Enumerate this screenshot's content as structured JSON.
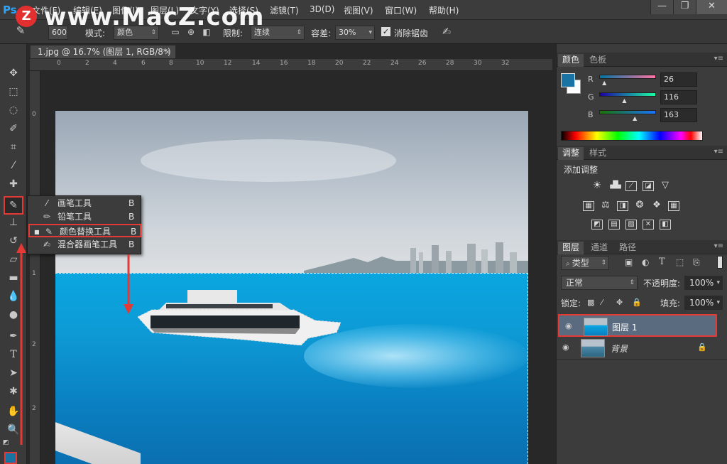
{
  "app": {
    "logo": "Ps",
    "menu": [
      "文件(F)",
      "编辑(E)",
      "图像(I)",
      "图层(L)",
      "文字(Y)",
      "选择(S)",
      "滤镜(T)",
      "3D(D)",
      "视图(V)",
      "窗口(W)",
      "帮助(H)"
    ],
    "window_buttons": [
      "—",
      "❐",
      "✕"
    ]
  },
  "watermark": {
    "logo": "Z",
    "text": "www.MacZ.com"
  },
  "options": {
    "brush_size": "600",
    "mode_label": "模式:",
    "mode_value": "颜色",
    "limit_label": "限制:",
    "limit_value": "连续",
    "tolerance_label": "容差:",
    "tolerance_value": "30%",
    "antialias_label": "消除锯齿",
    "antialias_checked": "✓"
  },
  "document": {
    "tab": "1.jpg @ 16.7% (图层 1, RGB/8*) *",
    "tab_close": "×",
    "ruler_top": [
      "0",
      "2",
      "4",
      "6",
      "8",
      "10",
      "12",
      "14",
      "16",
      "18",
      "20",
      "22",
      "24",
      "26",
      "28",
      "30",
      "32"
    ],
    "ruler_left": [
      "0",
      "1",
      "1",
      "2",
      "2"
    ]
  },
  "flyout": {
    "items": [
      {
        "label": "画笔工具",
        "key": "B",
        "icon": "brush-icon"
      },
      {
        "label": "铅笔工具",
        "key": "B",
        "icon": "pencil-icon"
      },
      {
        "label": "颜色替换工具",
        "key": "B",
        "icon": "color-replacement-icon"
      },
      {
        "label": "混合器画笔工具",
        "key": "B",
        "icon": "mixer-brush-icon"
      }
    ],
    "selected_marker": "■"
  },
  "color_panel": {
    "tabs": [
      "颜色",
      "色板"
    ],
    "r_label": "R",
    "g_label": "G",
    "b_label": "B",
    "r": "26",
    "g": "116",
    "b": "163",
    "r_value": 26,
    "g_value": 116,
    "b_value": 163,
    "foreground": "#1a74a3",
    "background": "#ffffff"
  },
  "adjust_panel": {
    "tabs": [
      "调整",
      "样式"
    ],
    "title": "添加调整"
  },
  "layers_panel": {
    "tabs": [
      "图层",
      "通道",
      "路径"
    ],
    "filter_label": "类型",
    "blend_mode": "正常",
    "opacity_label": "不透明度:",
    "opacity_value": "100%",
    "lock_label": "锁定:",
    "fill_label": "填充:",
    "fill_value": "100%",
    "layers": [
      {
        "name": "图层 1",
        "selected": true
      },
      {
        "name": "背景",
        "locked": true
      }
    ]
  },
  "colors": {
    "accent_red": "#e53935",
    "water": "#0aa6e0"
  }
}
